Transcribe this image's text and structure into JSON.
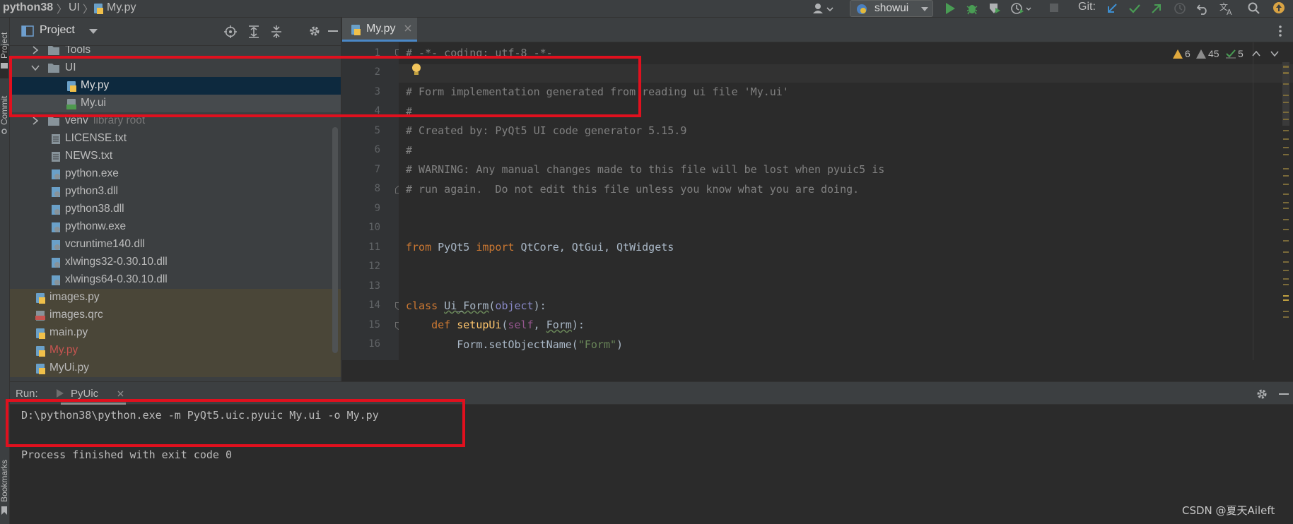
{
  "topbar": {
    "crumbs": [
      "python38",
      "UI",
      "My.py"
    ],
    "run_config": "showui",
    "git_label": "Git:"
  },
  "sidebar_stripe": {
    "project_label": "Project",
    "commit_label": "Commit",
    "bookmarks_label": "Bookmarks"
  },
  "project_panel": {
    "title": "Project",
    "tree": [
      {
        "label": "Tools",
        "kind": "folder",
        "expanded": false
      },
      {
        "label": "UI",
        "kind": "folder",
        "expanded": true
      },
      {
        "label": "My.py",
        "kind": "python"
      },
      {
        "label": "My.ui",
        "kind": "ui"
      },
      {
        "label": "venv",
        "hint": "library root",
        "kind": "folder",
        "expanded": false
      },
      {
        "label": "LICENSE.txt",
        "kind": "text"
      },
      {
        "label": "NEWS.txt",
        "kind": "text"
      },
      {
        "label": "python.exe",
        "kind": "exe"
      },
      {
        "label": "python3.dll",
        "kind": "dll"
      },
      {
        "label": "python38.dll",
        "kind": "dll"
      },
      {
        "label": "pythonw.exe",
        "kind": "exe"
      },
      {
        "label": "vcruntime140.dll",
        "kind": "dll"
      },
      {
        "label": "xlwings32-0.30.10.dll",
        "kind": "dll"
      },
      {
        "label": "xlwings64-0.30.10.dll",
        "kind": "dll"
      },
      {
        "label": "images.py",
        "kind": "python"
      },
      {
        "label": "images.qrc",
        "kind": "qrc"
      },
      {
        "label": "main.py",
        "kind": "python"
      },
      {
        "label": "My.py",
        "kind": "python",
        "modified": true
      },
      {
        "label": "MyUi.py",
        "kind": "python"
      }
    ]
  },
  "editor": {
    "tab_label": "My.py",
    "inspections": {
      "warnings": "6",
      "weak_warnings": "45",
      "typos": "5"
    },
    "line_numbers": [
      "1",
      "2",
      "3",
      "4",
      "5",
      "6",
      "7",
      "8",
      "9",
      "10",
      "11",
      "12",
      "13",
      "14",
      "15",
      "16"
    ],
    "lines": {
      "l1": "# -*- coding: utf-8 -*-",
      "l3": "# Form implementation generated from reading ui file 'My.ui'",
      "l4": "#",
      "l5": "# Created by: PyQt5 UI code generator 5.15.9",
      "l6": "#",
      "l7": "# WARNING: Any manual changes made to this file will be lost when pyuic5 is",
      "l8": "# run again.  Do not edit this file unless you know what you are doing.",
      "l11_from": "from",
      "l11_mod": " PyQt5 ",
      "l11_import": "import",
      "l11_rest": " QtCore, QtGui, QtWidgets",
      "l14_class": "class",
      "l14_name": "Ui_Form",
      "l14_base": "object",
      "l15_def": "def",
      "l15_name": "setupUi",
      "l15_self": "self",
      "l15_arg": "Form",
      "l16_call": "Form.setObjectName(",
      "l16_str": "\"Form\"",
      "l16_close": ")"
    }
  },
  "run_panel": {
    "run_label": "Run:",
    "tab_label": "PyUic",
    "command": "D:\\python38\\python.exe -m PyQt5.uic.pyuic My.ui -o My.py",
    "result": "Process finished with exit code 0"
  },
  "watermark": "CSDN @夏天Aileft",
  "colors": {
    "highlight_box": "#e0101e",
    "selection": "#0d293e",
    "keyword": "#cc7832",
    "string": "#6a8759",
    "comment": "#808080"
  }
}
